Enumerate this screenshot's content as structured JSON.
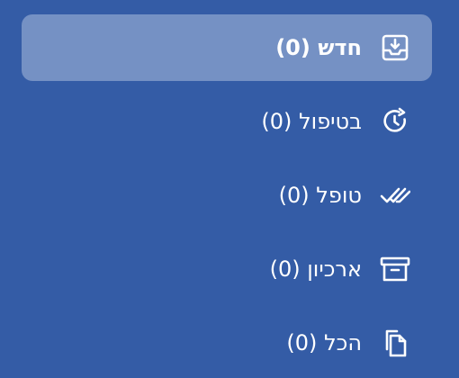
{
  "menu": {
    "items": [
      {
        "label": "חדש",
        "count": "(0)",
        "icon": "inbox-download-icon",
        "active": true
      },
      {
        "label": "בטיפול",
        "count": "(0)",
        "icon": "clock-refresh-icon",
        "active": false
      },
      {
        "label": "טופל",
        "count": "(0)",
        "icon": "double-check-icon",
        "active": false
      },
      {
        "label": "ארכיון",
        "count": "(0)",
        "icon": "archive-box-icon",
        "active": false
      },
      {
        "label": "הכל",
        "count": "(0)",
        "icon": "copy-documents-icon",
        "active": false
      }
    ]
  },
  "colors": {
    "background": "#345ca6",
    "active_background": "#7591c4",
    "text": "#ffffff"
  }
}
